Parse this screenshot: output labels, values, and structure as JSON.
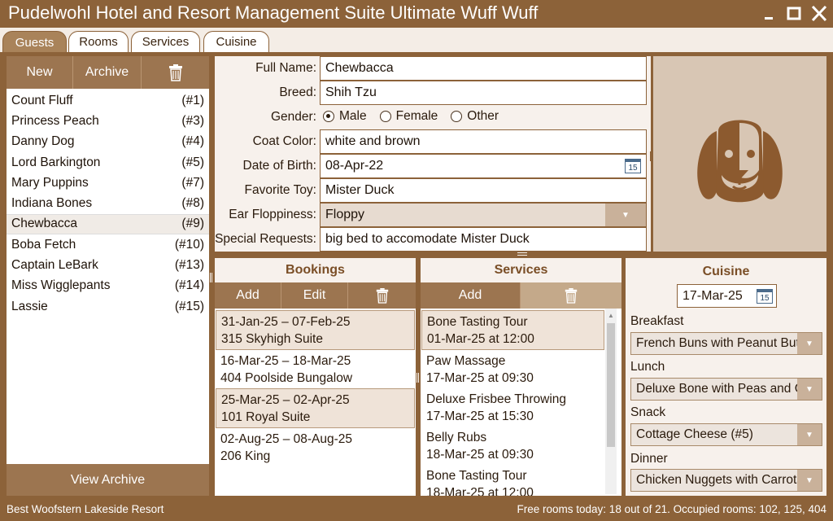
{
  "window": {
    "title": "Pudelwohl Hotel and Resort Management Suite Ultimate Wuff Wuff"
  },
  "tabs": [
    {
      "label": "Guests",
      "active": true
    },
    {
      "label": "Rooms",
      "active": false
    },
    {
      "label": "Services",
      "active": false
    },
    {
      "label": "Cuisine",
      "active": false
    }
  ],
  "guests": {
    "toolbar": {
      "new_label": "New",
      "archive_label": "Archive",
      "delete_icon": "trash-icon"
    },
    "items": [
      {
        "name": "Count Fluff",
        "id": "(#1)"
      },
      {
        "name": "Princess Peach",
        "id": "(#3)"
      },
      {
        "name": "Danny Dog",
        "id": "(#4)"
      },
      {
        "name": "Lord Barkington",
        "id": "(#5)"
      },
      {
        "name": "Mary Puppins",
        "id": "(#7)"
      },
      {
        "name": "Indiana Bones",
        "id": "(#8)"
      },
      {
        "name": "Chewbacca",
        "id": "(#9)"
      },
      {
        "name": "Boba Fetch",
        "id": "(#10)"
      },
      {
        "name": "Captain LeBark",
        "id": "(#13)"
      },
      {
        "name": "Miss Wigglepants",
        "id": "(#14)"
      },
      {
        "name": "Lassie",
        "id": "(#15)"
      }
    ],
    "selected_index": 6,
    "view_archive_label": "View Archive"
  },
  "form": {
    "full_name": {
      "label": "Full Name:",
      "value": "Chewbacca"
    },
    "breed": {
      "label": "Breed:",
      "value": "Shih Tzu"
    },
    "gender": {
      "label": "Gender:",
      "options": [
        "Male",
        "Female",
        "Other"
      ],
      "selected": "Male"
    },
    "coat_color": {
      "label": "Coat Color:",
      "value": "white and brown"
    },
    "dob": {
      "label": "Date of Birth:",
      "value": "08-Apr-22",
      "calendar_day": "15"
    },
    "favorite_toy": {
      "label": "Favorite Toy:",
      "value": "Mister Duck"
    },
    "ear_floppiness": {
      "label": "Ear Floppiness:",
      "value": "Floppy"
    },
    "special_requests": {
      "label": "Special Requests:",
      "value": "big bed to accomodate Mister Duck"
    }
  },
  "photo": {
    "icon": "dog-face-icon"
  },
  "bookings": {
    "title": "Bookings",
    "add_label": "Add",
    "edit_label": "Edit",
    "items": [
      {
        "dates": "31-Jan-25  –  07-Feb-25",
        "room": "315 Skyhigh Suite",
        "highlight": true
      },
      {
        "dates": "16-Mar-25  –  18-Mar-25",
        "room": "404 Poolside Bungalow",
        "highlight": false
      },
      {
        "dates": "25-Mar-25  –  02-Apr-25",
        "room": "101 Royal Suite",
        "highlight": true
      },
      {
        "dates": "02-Aug-25  –  08-Aug-25",
        "room": "206 King",
        "highlight": false
      }
    ]
  },
  "services": {
    "title": "Services",
    "add_label": "Add",
    "items": [
      {
        "name": "Bone Tasting Tour",
        "when": "01-Mar-25 at 12:00",
        "highlight": true
      },
      {
        "name": "Paw Massage",
        "when": "17-Mar-25 at 09:30",
        "highlight": false
      },
      {
        "name": "Deluxe Frisbee Throwing",
        "when": "17-Mar-25 at 15:30",
        "highlight": false
      },
      {
        "name": "Belly Rubs",
        "when": "18-Mar-25 at 09:30",
        "highlight": false
      },
      {
        "name": "Bone Tasting Tour",
        "when": "18-Mar-25 at 12:00",
        "highlight": false
      }
    ]
  },
  "cuisine": {
    "title": "Cuisine",
    "date": "17-Mar-25",
    "calendar_day": "15",
    "meals": [
      {
        "label": "Breakfast",
        "value": "French Buns with Peanut Butter"
      },
      {
        "label": "Lunch",
        "value": "Deluxe Bone with Peas and Carrots"
      },
      {
        "label": "Snack",
        "value": "Cottage Cheese (#5)"
      },
      {
        "label": "Dinner",
        "value": "Chicken Nuggets with Carrots"
      }
    ]
  },
  "status": {
    "left": "Best Woofstern Lakeside Resort",
    "right": "Free rooms today: 18 out of 21.  Occupied rooms: 102, 125, 404"
  },
  "colors": {
    "brand": "#8c6239",
    "panel": "#9c7550",
    "highlight": "#efe3d8"
  }
}
